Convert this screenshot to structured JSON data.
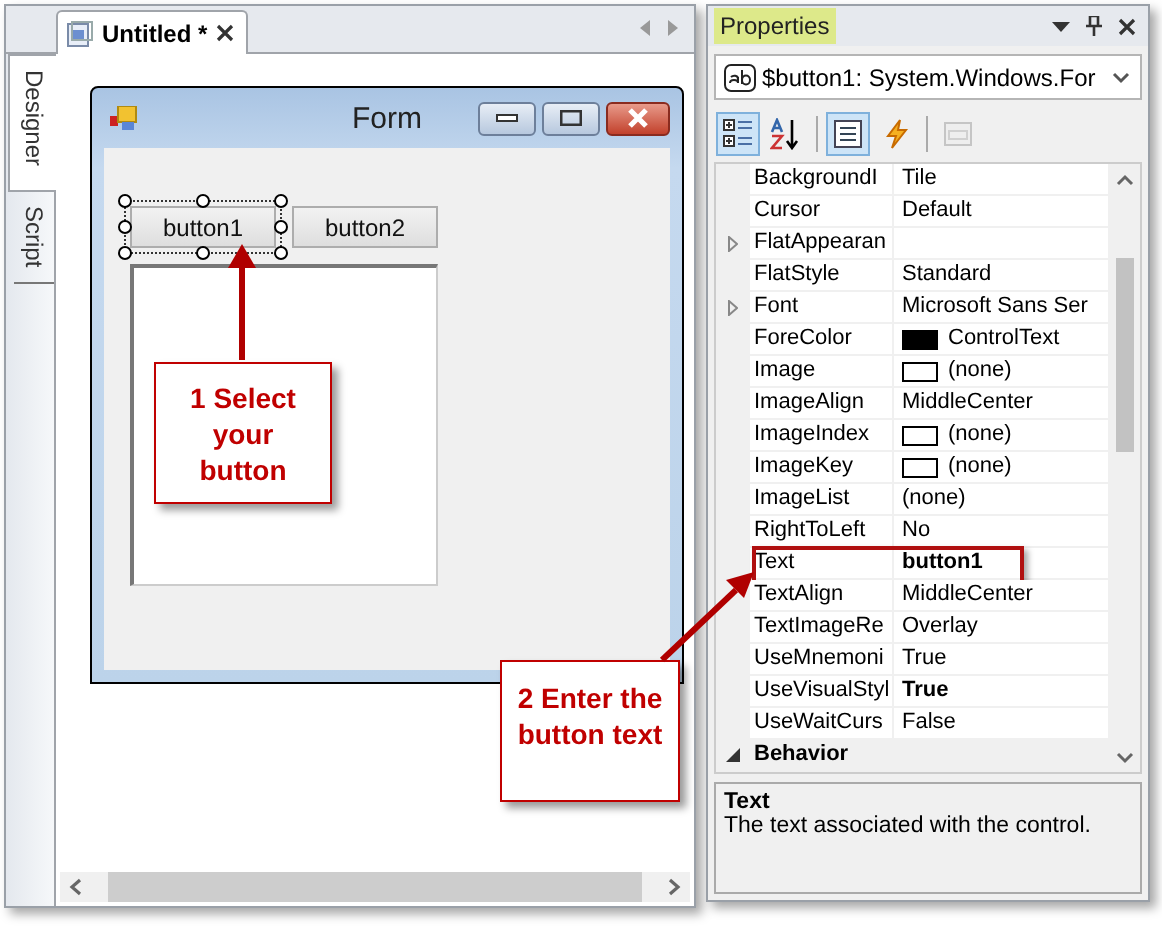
{
  "document_tab": {
    "title": "Untitled *",
    "selected": true
  },
  "side_tabs": [
    {
      "label": "Designer",
      "selected": true
    },
    {
      "label": "Script",
      "selected": false
    }
  ],
  "form": {
    "title": "Form",
    "buttons": [
      {
        "text": "button1",
        "selected": true
      },
      {
        "text": "button2",
        "selected": false
      }
    ]
  },
  "callouts": [
    {
      "text": "1 Select your button"
    },
    {
      "text": "2 Enter the button text"
    }
  ],
  "properties": {
    "title": "Properties",
    "object": "$button1: System.Windows.For",
    "toolbar": [
      {
        "kind": "categorized",
        "selected": true,
        "disabled": false
      },
      {
        "kind": "alphabetical",
        "selected": false,
        "disabled": false
      },
      {
        "kind": "properties",
        "selected": true,
        "disabled": false
      },
      {
        "kind": "events",
        "selected": false,
        "disabled": false
      },
      {
        "kind": "pages",
        "selected": false,
        "disabled": true
      }
    ],
    "rows": [
      {
        "kind": "property",
        "name": "BackgroundI",
        "value": "Tile",
        "expandable": false,
        "bold": false,
        "highlighted": false
      },
      {
        "kind": "property",
        "name": "Cursor",
        "value": "Default",
        "expandable": false,
        "bold": false,
        "highlighted": false
      },
      {
        "kind": "property",
        "name": "FlatAppearan",
        "expandable": true,
        "highlighted": false
      },
      {
        "kind": "property",
        "name": "FlatStyle",
        "value": "Standard",
        "expandable": false,
        "bold": false,
        "highlighted": false
      },
      {
        "kind": "property",
        "name": "Font",
        "value": "Microsoft Sans Ser",
        "expandable": true,
        "bold": false,
        "highlighted": false
      },
      {
        "kind": "property",
        "name": "ForeColor",
        "value": "ControlText",
        "color": "#000000",
        "expandable": false,
        "bold": false,
        "highlighted": false
      },
      {
        "kind": "property",
        "name": "Image",
        "value": "(none)",
        "color": "#ffffff",
        "expandable": false,
        "bold": false,
        "highlighted": false
      },
      {
        "kind": "property",
        "name": "ImageAlign",
        "value": "MiddleCenter",
        "expandable": false,
        "bold": false,
        "highlighted": false
      },
      {
        "kind": "property",
        "name": "ImageIndex",
        "value": "(none)",
        "color": "#ffffff",
        "expandable": false,
        "bold": false,
        "highlighted": false
      },
      {
        "kind": "property",
        "name": "ImageKey",
        "value": "(none)",
        "color": "#ffffff",
        "expandable": false,
        "bold": false,
        "highlighted": false
      },
      {
        "kind": "property",
        "name": "ImageList",
        "value": "(none)",
        "expandable": false,
        "bold": false,
        "highlighted": false
      },
      {
        "kind": "property",
        "name": "RightToLeft",
        "value": "No",
        "expandable": false,
        "bold": false,
        "highlighted": false
      },
      {
        "kind": "property",
        "name": "Text",
        "value": "button1",
        "expandable": false,
        "bold": true,
        "highlighted": true
      },
      {
        "kind": "property",
        "name": "TextAlign",
        "value": "MiddleCenter",
        "expandable": false,
        "bold": false,
        "highlighted": false
      },
      {
        "kind": "property",
        "name": "TextImageRe",
        "value": "Overlay",
        "expandable": false,
        "bold": false,
        "highlighted": false
      },
      {
        "kind": "property",
        "name": "UseMnemoni",
        "value": "True",
        "expandable": false,
        "bold": false,
        "highlighted": false
      },
      {
        "kind": "property",
        "name": "UseVisualStyl",
        "value": "True",
        "expandable": false,
        "bold": true,
        "highlighted": false
      },
      {
        "kind": "property",
        "name": "UseWaitCurs",
        "value": "False",
        "expandable": false,
        "bold": false,
        "highlighted": false
      },
      {
        "kind": "category",
        "name": "Behavior",
        "expanded": true
      }
    ],
    "description": {
      "title": "Text",
      "text": "The text associated with the control."
    }
  }
}
